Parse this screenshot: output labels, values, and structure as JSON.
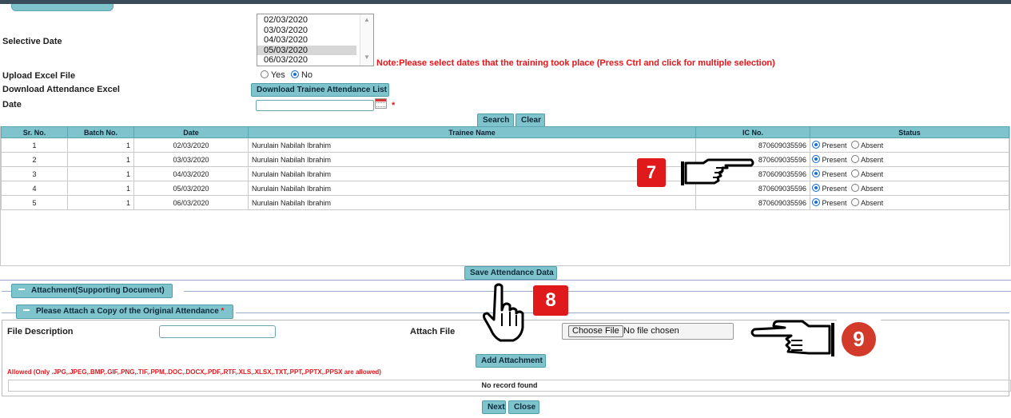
{
  "form": {
    "selective_date_label": "Selective Date",
    "dates": [
      "02/03/2020",
      "03/03/2020",
      "04/03/2020",
      "05/03/2020",
      "06/03/2020"
    ],
    "selected_date": "05/03/2020",
    "note": "Note:Please select dates that the training took place (Press Ctrl and click for multiple selection)",
    "upload_label": "Upload Excel File",
    "upload_yes": "Yes",
    "upload_no": "No",
    "upload_value": "No",
    "download_label": "Download Attendance Excel",
    "download_button": "Download Trainee Attendance List",
    "date_label": "Date",
    "date_value": "",
    "required_mark": "*",
    "search_button": "Search",
    "clear_button": "Clear"
  },
  "table": {
    "headers": [
      "Sr. No.",
      "Batch No.",
      "Date",
      "Trainee Name",
      "IC No.",
      "Status"
    ],
    "status_present": "Present",
    "status_absent": "Absent",
    "rows": [
      {
        "sr": "1",
        "batch": "1",
        "date": "02/03/2020",
        "name": "Nurulain Nabilah Ibrahim",
        "ic": "870609035596",
        "status": "Present"
      },
      {
        "sr": "2",
        "batch": "1",
        "date": "03/03/2020",
        "name": "Nurulain Nabilah Ibrahim",
        "ic": "870609035596",
        "status": "Present"
      },
      {
        "sr": "3",
        "batch": "1",
        "date": "04/03/2020",
        "name": "Nurulain Nabilah Ibrahim",
        "ic": "870609035596",
        "status": "Present"
      },
      {
        "sr": "4",
        "batch": "1",
        "date": "05/03/2020",
        "name": "Nurulain Nabilah Ibrahim",
        "ic": "870609035596",
        "status": "Present"
      },
      {
        "sr": "5",
        "batch": "1",
        "date": "06/03/2020",
        "name": "Nurulain Nabilah Ibrahim",
        "ic": "870609035596",
        "status": "Present"
      }
    ]
  },
  "save_button": "Save Attendance Data",
  "attachment": {
    "section_title": "Attachment(Supporting Document)",
    "subsection_title": "Please Attach a Copy of the Original Attendance",
    "required_mark": "*",
    "file_description_label": "File Description",
    "file_description_value": "",
    "attach_file_label": "Attach File",
    "choose_file_button": "Choose File",
    "no_file_text": "No file chosen",
    "add_button": "Add Attachment",
    "allowed_text": "Allowed (Only .JPG,.JPEG,.BMP,.GIF,.PNG,.TIF,.PPM,.DOC,.DOCX,.PDF,.RTF,.XLS,.XLSX,.TXT,.PPT,.PPTX,.PPSX are allowed)",
    "no_record_text": "No record found"
  },
  "footer": {
    "next_button": "Next",
    "close_button": "Close"
  },
  "callouts": {
    "step7": "7",
    "step8": "8",
    "step9": "9"
  },
  "colors": {
    "accent": "#7fc3cc",
    "required": "#e8141a",
    "callout_red": "#e01a1a"
  },
  "icons": [
    "calendar-icon",
    "pointing-hand-icon",
    "hand-cursor-icon"
  ]
}
